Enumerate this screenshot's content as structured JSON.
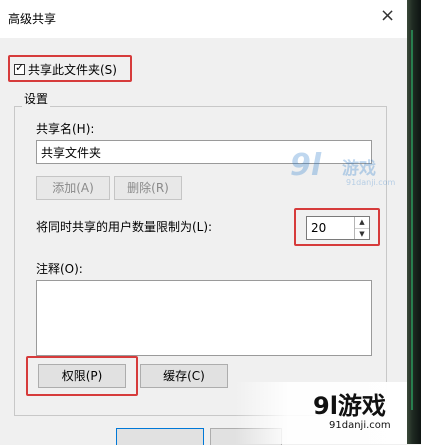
{
  "window": {
    "title": "高级共享",
    "close_glyph": "×"
  },
  "share_checkbox": {
    "label": "共享此文件夹(S)",
    "checked": true
  },
  "settings": {
    "group_title": "设置",
    "share_name_label": "共享名(H):",
    "share_name_value": "共享文件夹",
    "add_button": "添加(A)",
    "remove_button": "删除(R)",
    "limit_label": "将同时共享的用户数量限制为(L):",
    "limit_value": "20",
    "comment_label": "注释(O):",
    "comment_value": "",
    "permissions_button": "权限(P)",
    "cache_button": "缓存(C)"
  },
  "watermarks": {
    "top": {
      "logo": "9l",
      "text": "游戏",
      "url": "91danji.com"
    },
    "bottom": {
      "text": "9l游戏",
      "url": "91danji.com"
    }
  },
  "colors": {
    "highlight": "#d63b3b",
    "window_bg": "#f0f0f0",
    "accent_blue": "#0078d7"
  }
}
